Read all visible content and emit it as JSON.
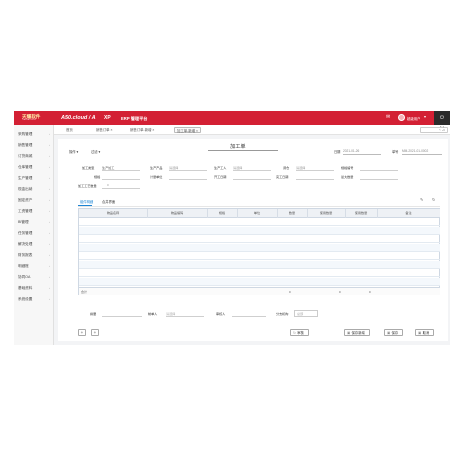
{
  "header": {
    "logo_main": "天耀软件",
    "logo_sub": "TIANYAO SOFT",
    "brand": "A50.cloud / A",
    "brand_xp": "XP",
    "brand_erp": "ERP 管理平台",
    "user": "超级用户",
    "icons": [
      "bell-icon",
      "user-icon",
      "power-icon"
    ]
  },
  "sidebar": {
    "items": [
      {
        "label": "采购管理"
      },
      {
        "label": "销售管理"
      },
      {
        "label": "订货商城"
      },
      {
        "label": "仓库管理"
      },
      {
        "label": "生产管理"
      },
      {
        "label": "现金出纳"
      },
      {
        "label": "固定资产"
      },
      {
        "label": "工资管理"
      },
      {
        "label": "BI管理"
      },
      {
        "label": "任务管理"
      },
      {
        "label": "解决处理"
      },
      {
        "label": "财务报表"
      },
      {
        "label": "明细账"
      },
      {
        "label": "协同OA"
      },
      {
        "label": "基础资料"
      },
      {
        "label": "系统设置"
      }
    ]
  },
  "tabs": [
    {
      "label": "首页"
    },
    {
      "label": "销售订单 ×"
    },
    {
      "label": "销售订单-新增 ×"
    },
    {
      "label": "加工单-新增 ×"
    }
  ],
  "tab_select_placeholder": "",
  "toolbar": {
    "ops_label": "操作",
    "filter_label": "过滤"
  },
  "form": {
    "title": "加工单",
    "date_label": "日期",
    "date_value": "2021-01-26",
    "no_label": "单号",
    "no_value": "MM-2021-01-0002",
    "fields": {
      "process_type_label": "加工类型",
      "process_type_value": "生产加工",
      "product_label": "生产产品",
      "product_placeholder": "请选择",
      "worker_label": "生产工人",
      "worker_placeholder": "请选择",
      "warehouse_label": "调仓",
      "warehouse_placeholder": "请选择",
      "spec_label": "规格编号",
      "model_label": "规格",
      "unit_label": "计量单位",
      "cost_label": "开工日期",
      "finish_label": "完工日期",
      "qty_label": "最大数量",
      "plan_qty_label": "加工工艺数量",
      "plan_qty_value": "0"
    },
    "subtabs": [
      "组件明细",
      "合并界面"
    ]
  },
  "grid": {
    "columns": [
      "物品名称",
      "物品编码",
      "规格",
      "单位",
      "数量",
      "使用数量",
      "使用数量",
      "备注"
    ],
    "rows": 8,
    "total_label": "合计",
    "total_values": [
      "0",
      "0",
      "0"
    ]
  },
  "bottom": {
    "memo_label": "摘要",
    "handler_label": "制单人",
    "handler_placeholder": "请选择",
    "auditor_label": "审核人",
    "org_label": "分支机构",
    "org_value": "总部"
  },
  "actions": {
    "add_label": "+",
    "remove_label": "+",
    "audit_label": "审核",
    "save_new_label": "保存新增",
    "save_label": "保存",
    "cancel_label": "取消"
  }
}
